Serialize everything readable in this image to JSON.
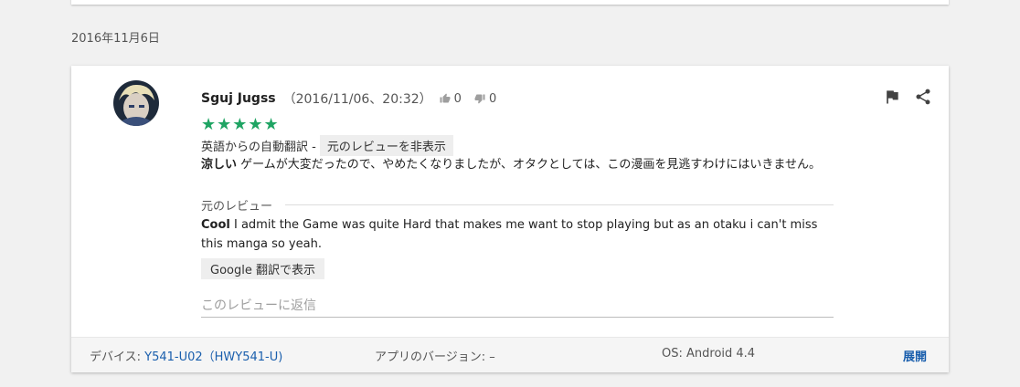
{
  "date_heading": "2016年11月6日",
  "review": {
    "author": "Sguj Jugss",
    "timestamp": "（2016/11/06、20:32）",
    "thumbs_up_count": "0",
    "thumbs_down_count": "0",
    "rating": 5,
    "stars_text": "★★★★★",
    "translated_from_label": "英語からの自動翻訳 -",
    "hide_original_label": "元のレビューを非表示",
    "translated_title": "涼しい",
    "translated_text": "ゲームが大変だったので、やめたくなりましたが、オタクとしては、この漫画を見逃すわけにはいきません。",
    "original_label": "元のレビュー",
    "original_title": "Cool",
    "original_text": "I admit the Game was quite Hard that makes me want to stop playing but as an otaku i can't miss this manga so yeah.",
    "google_translate_label": "Google 翻訳で表示",
    "reply_placeholder": "このレビューに返信"
  },
  "footer": {
    "device_label": "デバイス: ",
    "device_value": "Y541-U02（HWY541-U)",
    "app_version": "アプリのバージョン: –",
    "os": "OS: Android 4.4",
    "expand": "展開"
  },
  "icons": {
    "thumbs_up": "thumbs-up-icon",
    "thumbs_down": "thumbs-down-icon",
    "flag": "flag-icon",
    "share": "share-icon"
  },
  "colors": {
    "star": "#1fa463",
    "link": "#1a5fad",
    "background": "#f1f1f1"
  }
}
